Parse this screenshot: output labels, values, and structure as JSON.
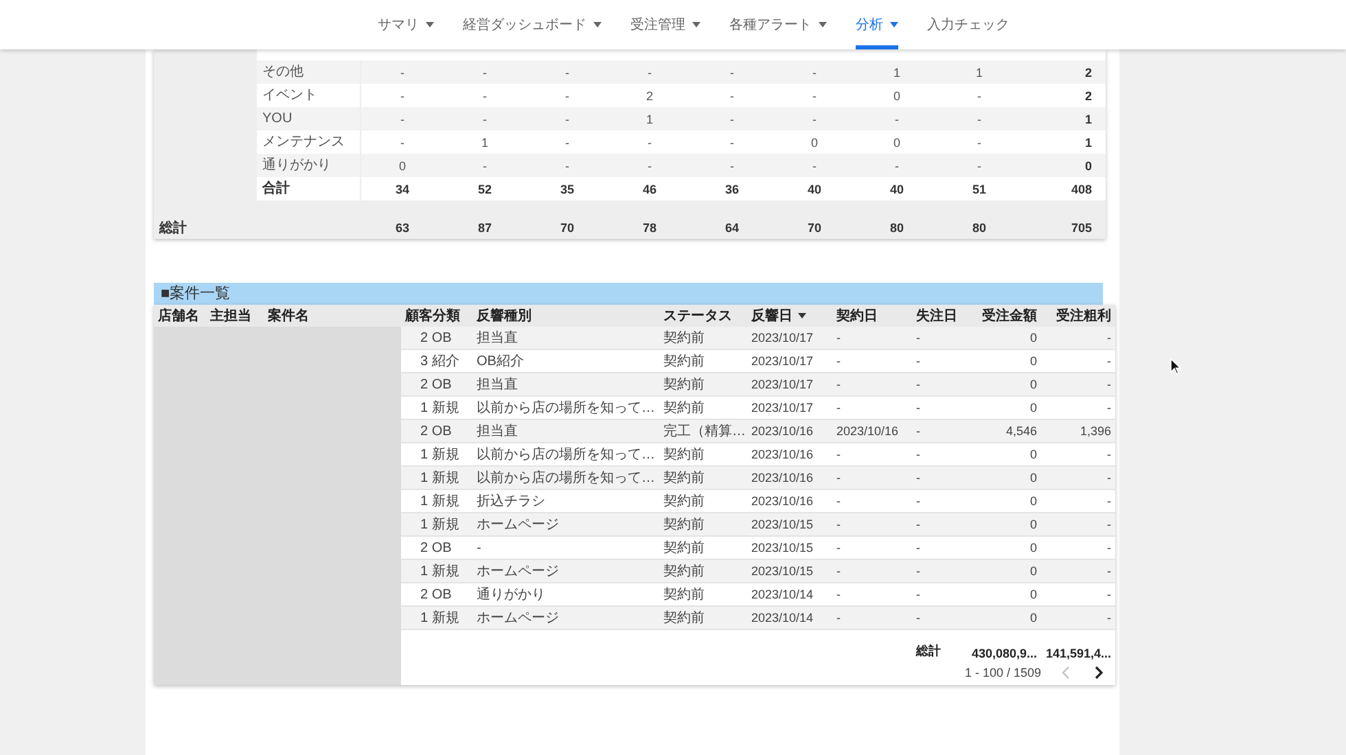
{
  "nav": {
    "items": [
      {
        "label": "サマリ",
        "dropdown": true,
        "selected": false
      },
      {
        "label": "経営ダッシュボード",
        "dropdown": true,
        "selected": false
      },
      {
        "label": "受注管理",
        "dropdown": true,
        "selected": false
      },
      {
        "label": "各種アラート",
        "dropdown": true,
        "selected": false
      },
      {
        "label": "分析",
        "dropdown": true,
        "selected": true
      },
      {
        "label": "入力チェック",
        "dropdown": false,
        "selected": false
      }
    ]
  },
  "summary_table": {
    "rows": [
      {
        "label": "その他",
        "kind": "normal",
        "values": [
          "-",
          "-",
          "-",
          "-",
          "-",
          "-",
          "1",
          "1",
          "2"
        ]
      },
      {
        "label": "イベント",
        "kind": "normal",
        "values": [
          "-",
          "-",
          "-",
          "2",
          "-",
          "-",
          "0",
          "-",
          "2"
        ]
      },
      {
        "label": "YOU",
        "kind": "normal",
        "values": [
          "-",
          "-",
          "-",
          "1",
          "-",
          "-",
          "-",
          "-",
          "1"
        ]
      },
      {
        "label": "メンテナンス",
        "kind": "normal",
        "values": [
          "-",
          "1",
          "-",
          "-",
          "-",
          "0",
          "0",
          "-",
          "1"
        ]
      },
      {
        "label": "通りがかり",
        "kind": "normal",
        "values": [
          "0",
          "-",
          "-",
          "-",
          "-",
          "-",
          "-",
          "-",
          "0"
        ]
      },
      {
        "label": "合計",
        "kind": "subtotal",
        "values": [
          "34",
          "52",
          "35",
          "46",
          "36",
          "40",
          "40",
          "51",
          "408"
        ]
      }
    ],
    "footer": {
      "label": "総計",
      "values": [
        "63",
        "87",
        "70",
        "78",
        "64",
        "70",
        "80",
        "80",
        "705"
      ]
    }
  },
  "cases": {
    "title": "■案件一覧",
    "columns": [
      {
        "label": "店舗名",
        "sorted": false
      },
      {
        "label": "主担当",
        "sorted": false
      },
      {
        "label": "案件名",
        "sorted": false
      },
      {
        "label": "顧客分類",
        "sorted": false
      },
      {
        "label": "反響種別",
        "sorted": false
      },
      {
        "label": "ステータス",
        "sorted": false
      },
      {
        "label": "反響日",
        "sorted": true
      },
      {
        "label": "契約日",
        "sorted": false
      },
      {
        "label": "失注日",
        "sorted": false
      },
      {
        "label": "受注金額",
        "sorted": false
      },
      {
        "label": "受注粗利",
        "sorted": false
      }
    ],
    "rows": [
      [
        "",
        "",
        "",
        "2 OB",
        "担当直",
        "契約前",
        "2023/10/17",
        "-",
        "-",
        "0",
        "-"
      ],
      [
        "",
        "",
        "",
        "3 紹介",
        "OB紹介",
        "契約前",
        "2023/10/17",
        "-",
        "-",
        "0",
        "-"
      ],
      [
        "",
        "",
        "",
        "2 OB",
        "担当直",
        "契約前",
        "2023/10/17",
        "-",
        "-",
        "0",
        "-"
      ],
      [
        "",
        "",
        "",
        "1 新規",
        "以前から店の場所を知って…",
        "契約前",
        "2023/10/17",
        "-",
        "-",
        "0",
        "-"
      ],
      [
        "",
        "",
        "",
        "2 OB",
        "担当直",
        "完工（精算…",
        "2023/10/16",
        "2023/10/16",
        "-",
        "4,546",
        "1,396"
      ],
      [
        "",
        "",
        "",
        "1 新規",
        "以前から店の場所を知って…",
        "契約前",
        "2023/10/16",
        "-",
        "-",
        "0",
        "-"
      ],
      [
        "",
        "",
        "",
        "1 新規",
        "以前から店の場所を知って…",
        "契約前",
        "2023/10/16",
        "-",
        "-",
        "0",
        "-"
      ],
      [
        "",
        "",
        "",
        "1 新規",
        "折込チラシ",
        "契約前",
        "2023/10/16",
        "-",
        "-",
        "0",
        "-"
      ],
      [
        "",
        "",
        "",
        "1 新規",
        "ホームページ",
        "契約前",
        "2023/10/15",
        "-",
        "-",
        "0",
        "-"
      ],
      [
        "",
        "",
        "",
        "2 OB",
        "-",
        "契約前",
        "2023/10/15",
        "-",
        "-",
        "0",
        "-"
      ],
      [
        "",
        "",
        "",
        "1 新規",
        "ホームページ",
        "契約前",
        "2023/10/15",
        "-",
        "-",
        "0",
        "-"
      ],
      [
        "",
        "",
        "",
        "2 OB",
        "通りがかり",
        "契約前",
        "2023/10/14",
        "-",
        "-",
        "0",
        "-"
      ],
      [
        "",
        "",
        "",
        "1 新規",
        "ホームページ",
        "契約前",
        "2023/10/14",
        "-",
        "-",
        "0",
        "-"
      ]
    ],
    "total_label": "総計",
    "totals": [
      "430,080,9...",
      "141,591,4..."
    ],
    "pagination": {
      "range": "1 - 100 / 1509",
      "prev_disabled": true,
      "next_disabled": false
    }
  }
}
